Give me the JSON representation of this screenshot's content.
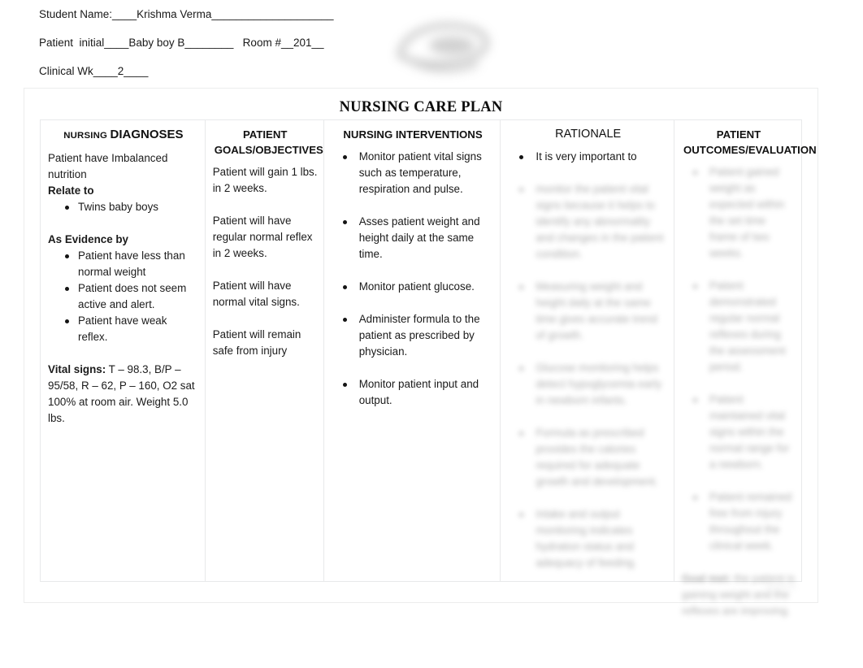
{
  "header": {
    "lines": [
      "Student Name:____Krishma Verma____________________",
      "Patient  initial____Baby boy B________   Room #__201__",
      "Clinical Wk____2____"
    ]
  },
  "logo": {
    "name": "school-logo-blurred",
    "alt": "blurred institutional logo"
  },
  "plan": {
    "title": "NURSING CARE PLAN"
  },
  "columns": {
    "diagnoses": {
      "head_small": "NURSING ",
      "head_big": "DIAGNOSES",
      "intro": "Patient have Imbalanced nutrition",
      "relate_label": "Relate to",
      "relate_items": [
        "Twins baby boys"
      ],
      "evidence_label": "As Evidence by",
      "evidence_items": [
        "Patient have less than normal weight",
        "Patient does not seem active and alert.",
        "Patient have weak reflex."
      ],
      "vitals_label": "Vital signs:",
      "vitals_text": " T – 98.3, B/P – 95/58, R – 62, P – 160, O2 sat 100% at room air. Weight 5.0 lbs."
    },
    "goals": {
      "head_line1": "PATIENT",
      "head_line2": "GOALS/OBJECTIVES",
      "items": [
        "Patient will gain 1 lbs. in 2 weeks.",
        "Patient will have regular normal reflex in 2 weeks.",
        "Patient will have normal vital signs.",
        "Patient will remain safe from injury"
      ]
    },
    "interventions": {
      "head": "NURSING INTERVENTIONS",
      "items": [
        "Monitor patient vital signs such as temperature, respiration and pulse.",
        "Asses patient weight and height daily at the same time.",
        "Monitor patient glucose.",
        "Administer formula to the patient as prescribed by physician.",
        "Monitor patient input and output."
      ]
    },
    "rationale": {
      "head": "RATIONALE",
      "items": [
        "It is very important to"
      ],
      "redacted_items": [
        "monitor the patient vital signs because it helps to identify any abnormality and changes in the patient condition.",
        "Measuring weight and height daily at the same time gives accurate trend of growth.",
        "Glucose monitoring helps detect hypoglycemia early in newborn infants.",
        "Formula as prescribed provides the calories required for adequate growth and development.",
        "Intake and output monitoring indicates hydration status and adequacy of feeding."
      ]
    },
    "outcomes": {
      "head_line1": "PATIENT",
      "head_line2": "OUTCOMES/EVALUATION",
      "redacted_items": [
        "Patient gained weight as expected within the set time frame of two weeks.",
        "Patient demonstrated regular normal reflexes during the assessment period.",
        "Patient maintained vital signs within the normal range for a newborn.",
        "Patient remained free from injury throughout the clinical week."
      ],
      "redacted_note_label": "Goal met:",
      "redacted_note_text": " the patient is gaining weight and the reflexes are improving."
    }
  },
  "watermark": {
    "text": "studocu"
  }
}
